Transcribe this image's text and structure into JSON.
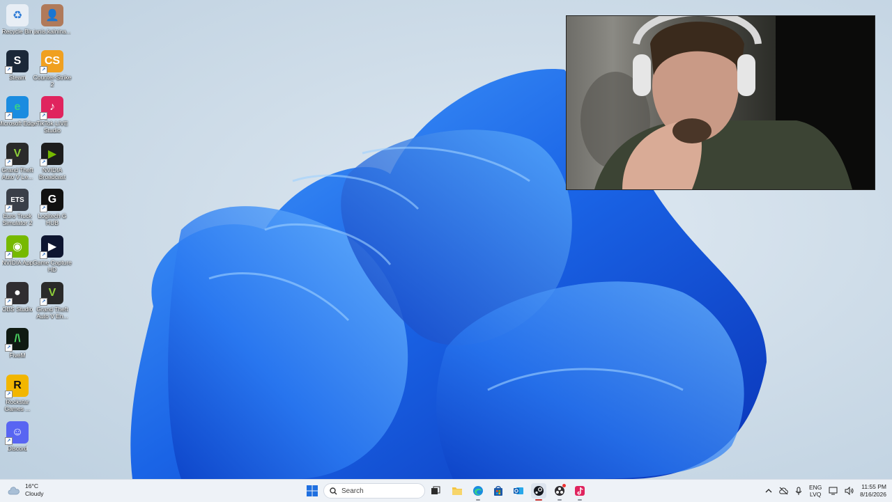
{
  "desktop": {
    "icons": [
      {
        "label": "Recycle Bin",
        "icon": "recycle-bin-icon"
      },
      {
        "label": "janis.kalnina...",
        "icon": "user-folder-icon"
      },
      {
        "label": "Steam",
        "icon": "steam-icon"
      },
      {
        "label": "Counter-Strike 2",
        "icon": "counter-strike-icon"
      },
      {
        "label": "Microsoft Edge",
        "icon": "edge-icon"
      },
      {
        "label": "TikTok LIVE Studio",
        "icon": "tiktok-icon"
      },
      {
        "label": "Grand Theft Auto V Le...",
        "icon": "gta-icon"
      },
      {
        "label": "NVIDIA Broadcast",
        "icon": "nvidia-broadcast-icon"
      },
      {
        "label": "Euro Truck Simulator 2",
        "icon": "euro-truck-icon"
      },
      {
        "label": "Logitech G HUB",
        "icon": "logitech-icon"
      },
      {
        "label": "NVIDIA App",
        "icon": "nvidia-icon"
      },
      {
        "label": "Game Capture HD",
        "icon": "game-capture-icon"
      },
      {
        "label": "OBS Studio",
        "icon": "obs-icon"
      },
      {
        "label": "Grand Theft Auto V En...",
        "icon": "gta-icon"
      },
      {
        "label": "FiveM",
        "icon": "fivem-icon"
      },
      {
        "label": "Rockstar Games ...",
        "icon": "rockstar-icon"
      },
      {
        "label": "Discord",
        "icon": "discord-icon"
      }
    ]
  },
  "taskbar": {
    "weather": {
      "temp": "16°C",
      "condition": "Cloudy"
    },
    "search_placeholder": "Search",
    "tray": {
      "lang_top": "ENG",
      "lang_bottom": "LVQ"
    },
    "clock": {
      "time": "11:55 PM",
      "date": "8/16/2026"
    }
  },
  "colors": {
    "accent": "#1e6fe0",
    "taskbar_bg": "#eef2f7"
  }
}
